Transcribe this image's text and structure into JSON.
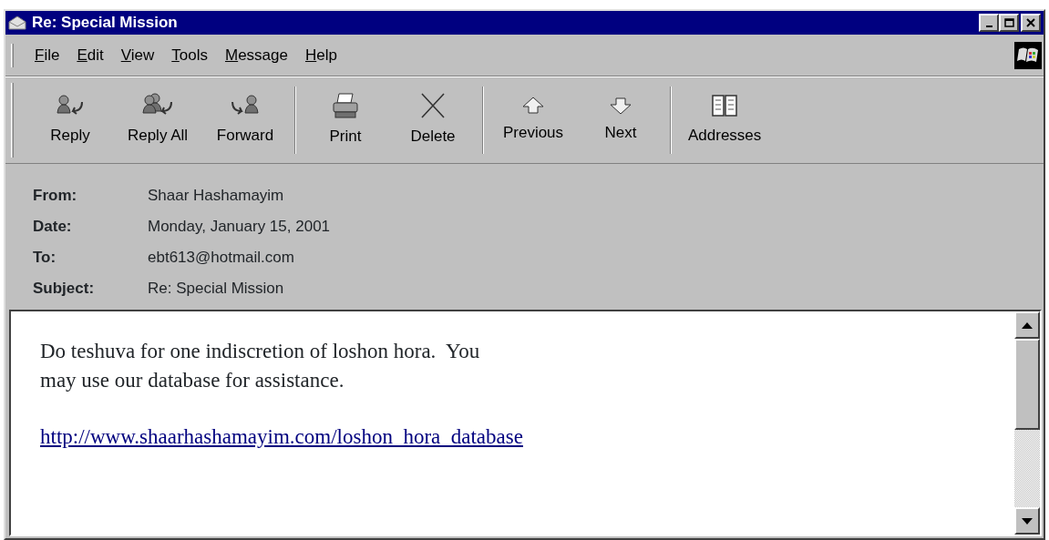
{
  "window": {
    "title": "Re: Special Mission",
    "controls": [
      {
        "kind": "minimize"
      },
      {
        "kind": "maximize"
      },
      {
        "kind": "close"
      }
    ]
  },
  "menu": [
    {
      "label": "File"
    },
    {
      "label": "Edit"
    },
    {
      "label": "View"
    },
    {
      "label": "Tools"
    },
    {
      "label": "Message"
    },
    {
      "label": "Help"
    }
  ],
  "toolbar": [
    {
      "label": "Reply",
      "kind": "reply",
      "separator_before": false
    },
    {
      "label": "Reply All",
      "kind": "replyall",
      "separator_before": false
    },
    {
      "label": "Forward",
      "kind": "forward",
      "separator_before": false
    },
    {
      "label": "Print",
      "kind": "print",
      "separator_before": true
    },
    {
      "label": "Delete",
      "kind": "delete",
      "separator_before": false
    },
    {
      "label": "Previous",
      "kind": "up",
      "separator_before": true
    },
    {
      "label": "Next",
      "kind": "down",
      "separator_before": false
    },
    {
      "label": "Addresses",
      "kind": "book",
      "separator_before": true
    }
  ],
  "header": [
    {
      "label": "From:",
      "value": "Shaar Hashamayim"
    },
    {
      "label": "Date:",
      "value": "Monday, January 15, 2001"
    },
    {
      "label": "To:",
      "value": "ebt613@hotmail.com"
    },
    {
      "label": "Subject:",
      "value": "Re: Special Mission"
    }
  ],
  "body": {
    "paragraphs": [
      "Do teshuva for one indiscretion of loshon hora.  You\nmay use our database for assistance."
    ],
    "link": "http://www.shaarhashamayim.com/loshon_hora_database"
  }
}
